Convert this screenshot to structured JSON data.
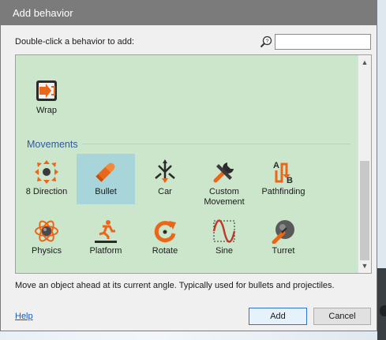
{
  "dialog": {
    "title": "Add behavior",
    "prompt": "Double-click a behavior to add:",
    "search": {
      "value": "",
      "placeholder": ""
    },
    "description": "Move an object ahead at its current angle.  Typically used for bullets and projectiles.",
    "help_label": "Help",
    "add_label": "Add",
    "cancel_label": "Cancel"
  },
  "list": {
    "top_items": [
      {
        "label": "Wrap",
        "icon": "wrap-icon"
      }
    ],
    "section": {
      "title": "Movements",
      "selected": "Bullet",
      "items": [
        {
          "label": "8 Direction",
          "icon": "eight-direction-icon"
        },
        {
          "label": "Bullet",
          "icon": "bullet-icon"
        },
        {
          "label": "Car",
          "icon": "car-icon"
        },
        {
          "label": "Custom Movement",
          "icon": "custom-movement-icon"
        },
        {
          "label": "Pathfinding",
          "icon": "pathfinding-icon"
        },
        {
          "label": "Physics",
          "icon": "physics-icon"
        },
        {
          "label": "Platform",
          "icon": "platform-icon"
        },
        {
          "label": "Rotate",
          "icon": "rotate-icon"
        },
        {
          "label": "Sine",
          "icon": "sine-icon"
        },
        {
          "label": "Turret",
          "icon": "turret-icon"
        }
      ]
    }
  },
  "colors": {
    "title_bar": "#7b7b7b",
    "list_background": "#cce6cc",
    "selection": "#a7d5d9",
    "section_title": "#2e58a6",
    "icon_orange": "#e8671a"
  }
}
